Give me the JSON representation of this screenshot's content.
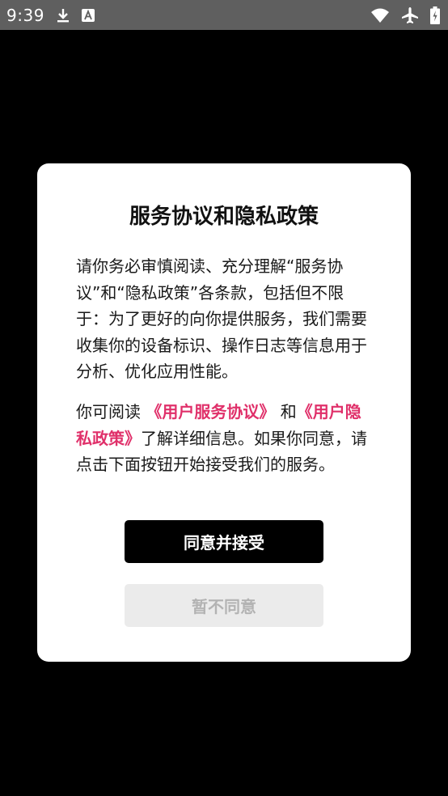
{
  "status_bar": {
    "time": "9:39",
    "icons": [
      "download-icon",
      "text-badge-icon",
      "wifi-icon",
      "airplane-icon",
      "battery-icon"
    ]
  },
  "dialog": {
    "title": "服务协议和隐私政策",
    "paragraph1": "请你务必审慎阅读、充分理解“服务协议”和“隐私政策”各条款，包括但不限于：为了更好的向你提供服务，我们需要收集你的设备标识、操作日志等信息用于分析、优化应用性能。",
    "paragraph2": {
      "prefix": "你可阅读 ",
      "link_user_agreement": "《用户服务协议》",
      "middle": " 和",
      "link_privacy_policy": "《用户隐私政策》",
      "suffix": "了解详细信息。如果你同意，请点击下面按钮开始接受我们的服务。"
    },
    "agree_button": "同意并接受",
    "disagree_button": "暂不同意"
  },
  "colors": {
    "status_bar_bg": "#5f5f5f",
    "background": "#000000",
    "dialog_bg": "#ffffff",
    "link": "#e0306a",
    "agree_bg": "#000000",
    "disagree_bg": "#ebebeb",
    "disagree_text": "#b3b3b3"
  }
}
